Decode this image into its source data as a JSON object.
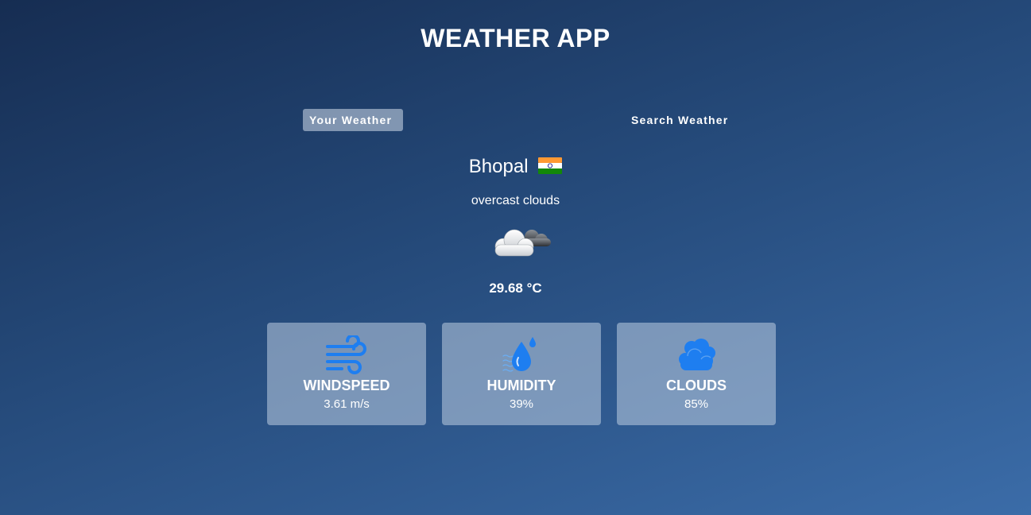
{
  "app": {
    "title": "WEATHER APP"
  },
  "tabs": [
    {
      "label": "Your Weather",
      "active": true
    },
    {
      "label": "Search Weather",
      "active": false
    }
  ],
  "location": {
    "city": "Bhopal",
    "country_flag_icon": "india-flag-icon"
  },
  "weather": {
    "description": "overcast clouds",
    "icon": "overcast-clouds-icon",
    "temperature": "29.68 °C"
  },
  "stats": [
    {
      "label": "WINDSPEED",
      "value": "3.61 m/s",
      "icon": "wind-icon"
    },
    {
      "label": "HUMIDITY",
      "value": "39%",
      "icon": "humidity-icon"
    },
    {
      "label": "CLOUDS",
      "value": "85%",
      "icon": "cloud-icon"
    }
  ],
  "colors": {
    "background_start": "#162d52",
    "background_end": "#3b6ca8",
    "icon_blue": "#1e7ef0",
    "text": "#ffffff"
  }
}
